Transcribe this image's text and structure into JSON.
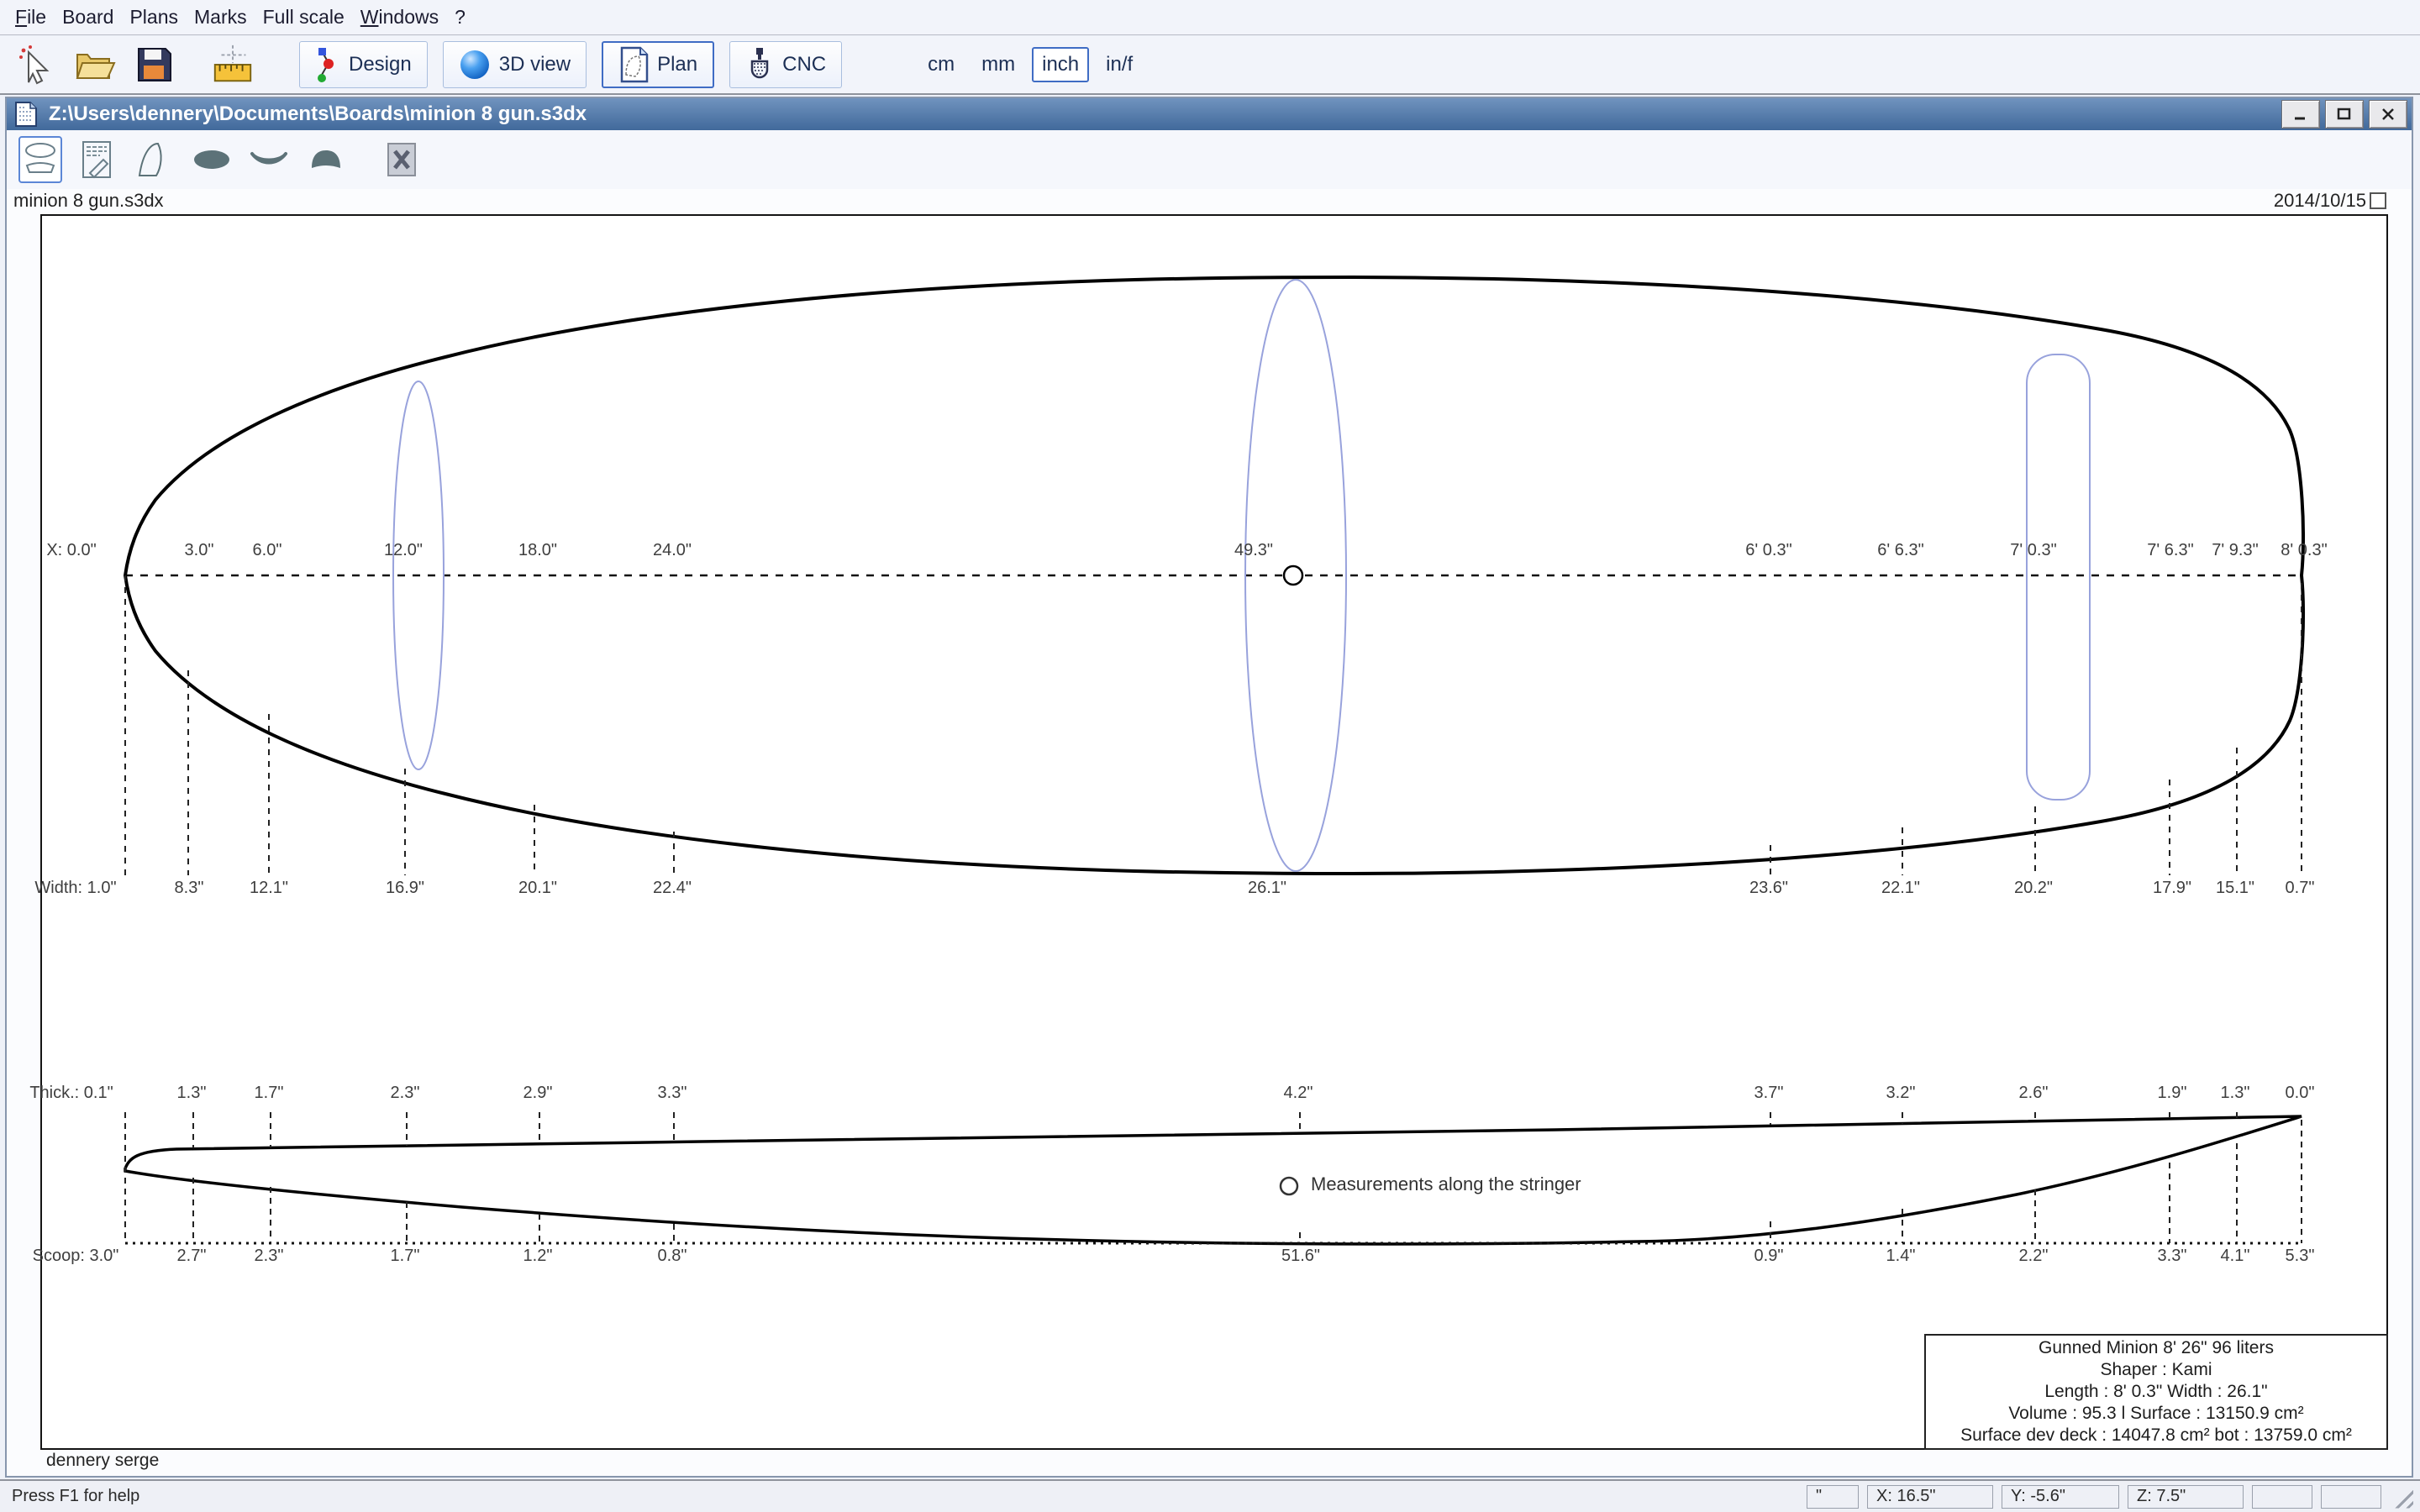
{
  "menu": {
    "items": [
      {
        "label": "File",
        "u": true
      },
      {
        "label": "Board",
        "u": false
      },
      {
        "label": "Plans",
        "u": false
      },
      {
        "label": "Marks",
        "u": false
      },
      {
        "label": "Full scale",
        "u": false
      },
      {
        "label": "Windows",
        "u": true
      },
      {
        "label": "?",
        "u": false
      }
    ]
  },
  "toolbar": {
    "buttons": [
      {
        "label": "Design"
      },
      {
        "label": "3D view"
      },
      {
        "label": "Plan"
      },
      {
        "label": "CNC"
      }
    ],
    "units": [
      {
        "label": "cm"
      },
      {
        "label": "mm"
      },
      {
        "label": "inch"
      },
      {
        "label": "in/f"
      }
    ]
  },
  "window": {
    "title": "Z:\\Users\\dennery\\Documents\\Boards\\minion 8 gun.s3dx",
    "file_label": "minion 8 gun.s3dx",
    "date": "2014/10/15",
    "author": "dennery serge"
  },
  "plan": {
    "x_row": [
      "X: 0.0\"",
      "3.0\"",
      "6.0\"",
      "12.0\"",
      "18.0\"",
      "24.0\"",
      "49.3\"",
      "6' 0.3\"",
      "6' 6.3\"",
      "7' 0.3\"",
      "7' 6.3\"",
      "7' 9.3\"",
      "8' 0.3\""
    ],
    "width_row": [
      "Width: 1.0\"",
      "8.3\"",
      "12.1\"",
      "16.9\"",
      "20.1\"",
      "22.4\"",
      "26.1\"",
      "23.6\"",
      "22.1\"",
      "20.2\"",
      "17.9\"",
      "15.1\"",
      "0.7\""
    ],
    "thick_row": [
      "Thick.: 0.1\"",
      "1.3\"",
      "1.7\"",
      "2.3\"",
      "2.9\"",
      "3.3\"",
      "4.2\"",
      "3.7\"",
      "3.2\"",
      "2.6\"",
      "1.9\"",
      "1.3\"",
      "0.0\""
    ],
    "scoop_row": [
      "Scoop: 3.0\"",
      "2.7\"",
      "2.3\"",
      "1.7\"",
      "1.2\"",
      "0.8\"",
      "51.6\"",
      "0.9\"",
      "1.4\"",
      "2.2\"",
      "3.3\"",
      "4.1\"",
      "5.3\""
    ],
    "stringer_note": "Measurements along the stringer"
  },
  "info_box": {
    "line1": "Gunned Minion 8' 26\" 96 liters",
    "line2": "Shaper : Kami",
    "line3": "Length : 8' 0.3\" Width  : 26.1\"",
    "line4": "Volume :  95.3 l  Surface : 13150.9 cm²",
    "line5": "Surface dev deck : 14047.8 cm² bot : 13759.0 cm²"
  },
  "status": {
    "help": "Press F1 for help",
    "unit": "\"",
    "x": "X: 16.5\"",
    "y": "Y: -5.6\"",
    "z": "Z: 7.5\""
  },
  "colors": {
    "titlebar_blue": "#41699b",
    "selection_blue": "#3f6cc4",
    "overlay_blue": "#98a2dc",
    "slate_icon": "#5c7278"
  }
}
